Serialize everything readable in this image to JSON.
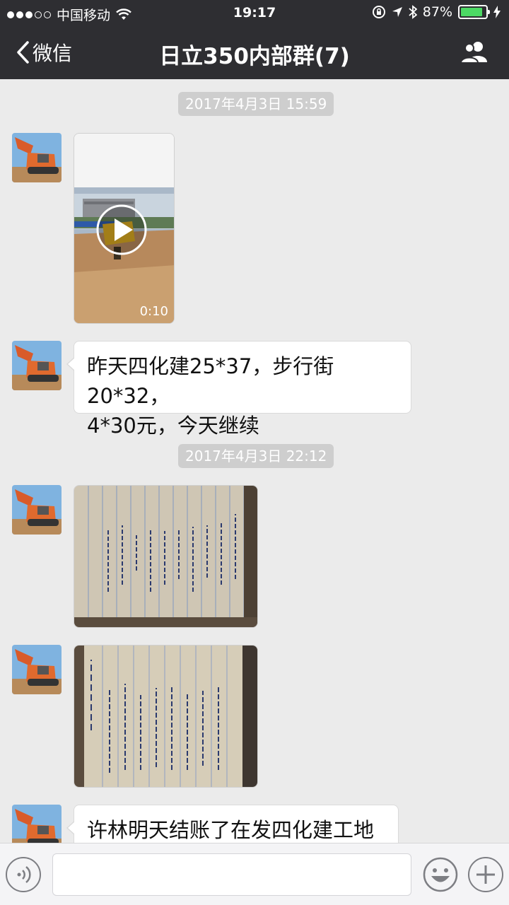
{
  "status_bar": {
    "carrier": "中国移动",
    "time": "19:17",
    "battery": "87%",
    "battery_level": 0.87
  },
  "nav": {
    "back_label": "微信",
    "title": "日立350内部群(7)"
  },
  "messages": [
    {
      "type": "timestamp",
      "text": "2017年4月3日 15:59"
    },
    {
      "type": "video",
      "duration": "0:10"
    },
    {
      "type": "text",
      "lines": [
        "昨天四化建25*37，步行街20*32，",
        "4*30元，今天继续"
      ]
    },
    {
      "type": "timestamp",
      "text": "2017年4月3日 22:12"
    },
    {
      "type": "image",
      "subject": "handwritten-ledger-page"
    },
    {
      "type": "image",
      "subject": "meeting-notes-page"
    },
    {
      "type": "text",
      "lines": [
        "许林明天结账了在发四化建工地照"
      ]
    }
  ],
  "colors": {
    "nav_bg": "#2e2e32",
    "chat_bg": "#ebebeb",
    "battery_fill": "#4cd964",
    "timestamp_bg": "#cecece"
  }
}
